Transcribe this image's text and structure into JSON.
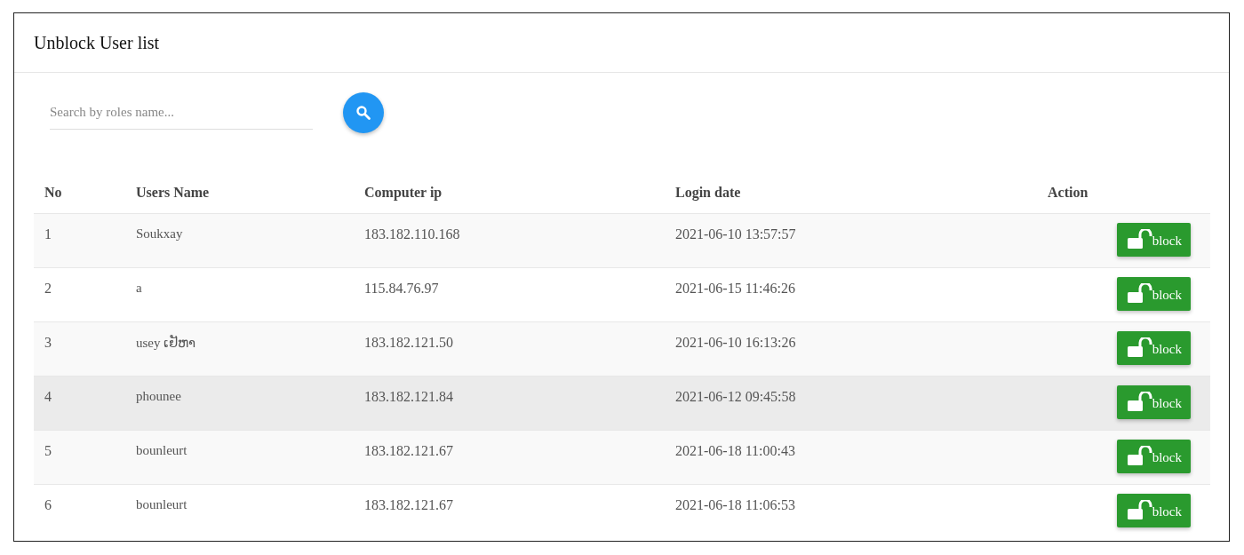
{
  "card": {
    "title": "Unblock User list"
  },
  "search": {
    "placeholder": "Search by roles name..."
  },
  "table": {
    "columns": [
      "No",
      "Users Name",
      "Computer ip",
      "Login date",
      "Action"
    ],
    "rows": [
      {
        "no": "1",
        "name": "Soukxay",
        "ip": "183.182.110.168",
        "date": "2021-06-10 13:57:57",
        "action": "block",
        "hovered": false
      },
      {
        "no": "2",
        "name": "a",
        "ip": "115.84.76.97",
        "date": "2021-06-15 11:46:26",
        "action": "block",
        "hovered": false
      },
      {
        "no": "3",
        "name": "usey ເຢັຫາ",
        "ip": "183.182.121.50",
        "date": "2021-06-10 16:13:26",
        "action": "block",
        "hovered": false
      },
      {
        "no": "4",
        "name": "phounee",
        "ip": "183.182.121.84",
        "date": "2021-06-12 09:45:58",
        "action": "block",
        "hovered": true
      },
      {
        "no": "5",
        "name": "bounleurt",
        "ip": "183.182.121.67",
        "date": "2021-06-18 11:00:43",
        "action": "block",
        "hovered": false
      },
      {
        "no": "6",
        "name": "bounleurt",
        "ip": "183.182.121.67",
        "date": "2021-06-18 11:06:53",
        "action": "block",
        "hovered": false
      }
    ]
  }
}
